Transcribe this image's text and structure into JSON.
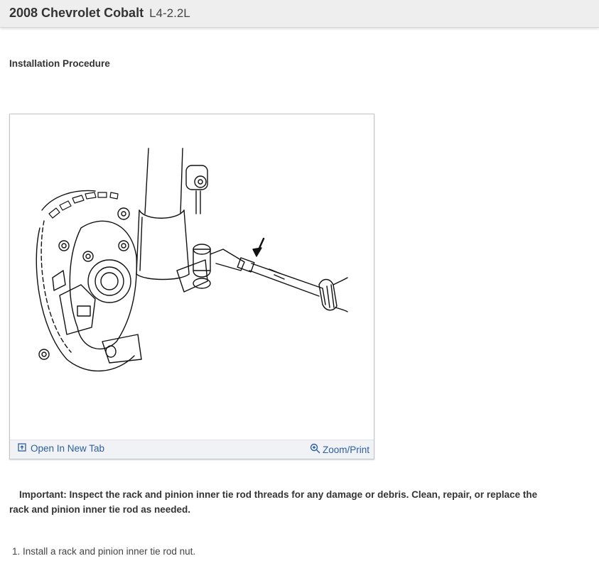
{
  "header": {
    "vehicle": "2008 Chevrolet Cobalt",
    "engine": "L4-2.2L"
  },
  "section_title": "Installation Procedure",
  "figure": {
    "open_tab_label": "Open In New Tab",
    "open_tab_icon": "open-in-new-tab-icon",
    "zoom_label": "Zoom/Print",
    "zoom_icon": "zoom-in-icon"
  },
  "important_note": "Important: Inspect the rack and pinion inner tie rod threads for any damage or debris. Clean, repair, or replace the rack and pinion inner tie rod as needed.",
  "steps": [
    {
      "number": "1.",
      "text": "Install a rack and pinion inner tie rod nut."
    }
  ]
}
